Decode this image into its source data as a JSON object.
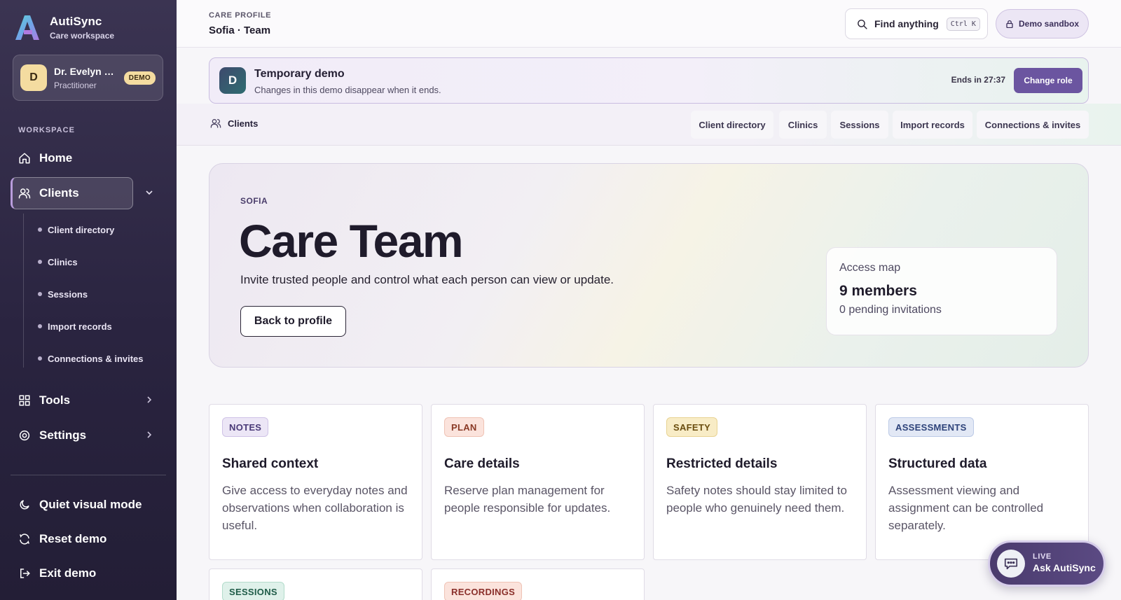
{
  "brand": {
    "name": "AutiSync",
    "subtitle": "Care workspace"
  },
  "user": {
    "initial": "D",
    "name": "Dr. Evelyn Carter",
    "role": "Practitioner",
    "badge": "DEMO"
  },
  "sidebar": {
    "section_label": "WORKSPACE",
    "items": [
      {
        "label": "Home",
        "icon": "home-icon"
      },
      {
        "label": "Clients",
        "icon": "users-icon",
        "active": true,
        "expanded": true
      },
      {
        "label": "Tools",
        "icon": "grid-icon"
      },
      {
        "label": "Settings",
        "icon": "gear-icon"
      }
    ],
    "sub_items": [
      "Client directory",
      "Clinics",
      "Sessions",
      "Import records",
      "Connections & invites"
    ],
    "bottom_items": [
      {
        "label": "Quiet visual mode",
        "icon": "moon-icon"
      },
      {
        "label": "Reset demo",
        "icon": "refresh-icon"
      },
      {
        "label": "Exit demo",
        "icon": "exit-icon"
      }
    ]
  },
  "topbar": {
    "crumb_label": "CARE PROFILE",
    "crumb_title": "Sofia · Team",
    "search_label": "Find anything",
    "search_kbd": "Ctrl K",
    "sandbox_label": "Demo sandbox"
  },
  "banner": {
    "initial": "D",
    "title": "Temporary demo",
    "subtitle": "Changes in this demo disappear when it ends.",
    "ends": "Ends in 27:37",
    "button": "Change role"
  },
  "subnav": {
    "section": "Clients",
    "tabs": [
      "Client directory",
      "Clinics",
      "Sessions",
      "Import records",
      "Connections & invites"
    ]
  },
  "hero": {
    "eyebrow": "SOFIA",
    "title": "Care Team",
    "description": "Invite trusted people and control what each person can view or update.",
    "back_button": "Back to profile",
    "access": {
      "label": "Access map",
      "count": "9 members",
      "pending": "0 pending invitations"
    }
  },
  "cards": [
    {
      "tag": "NOTES",
      "title": "Shared context",
      "text": "Give access to everyday notes and observations when collaboration is useful.",
      "tag_bg": "#ece6f6",
      "tag_fg": "#4a3a78",
      "tag_border": "#cfc2e6"
    },
    {
      "tag": "PLAN",
      "title": "Care details",
      "text": "Reserve plan management for people responsible for updates.",
      "tag_bg": "#fbe3dc",
      "tag_fg": "#8a3a26",
      "tag_border": "#efc3b5"
    },
    {
      "tag": "SAFETY",
      "title": "Restricted details",
      "text": "Safety notes should stay limited to people who genuinely need them.",
      "tag_bg": "#f8ecc6",
      "tag_fg": "#6b4e10",
      "tag_border": "#e8d393"
    },
    {
      "tag": "ASSESSMENTS",
      "title": "Structured data",
      "text": "Assessment viewing and assignment can be controlled separately.",
      "tag_bg": "#e2e8f5",
      "tag_fg": "#2e437a",
      "tag_border": "#bccae6"
    },
    {
      "tag": "SESSIONS",
      "title": "",
      "text": "",
      "tag_bg": "#dff1ea",
      "tag_fg": "#1f5c48",
      "tag_border": "#b3dccb"
    },
    {
      "tag": "RECORDINGS",
      "title": "",
      "text": "",
      "tag_bg": "#fbe3dc",
      "tag_fg": "#8a2f2a",
      "tag_border": "#efc3b5"
    }
  ],
  "chat": {
    "live": "LIVE",
    "label": "Ask AutiSync"
  },
  "colors": {
    "accent": "#6b55a0",
    "sidebar_bg": "#2a2440",
    "demo_badge": "#f4dca0"
  }
}
